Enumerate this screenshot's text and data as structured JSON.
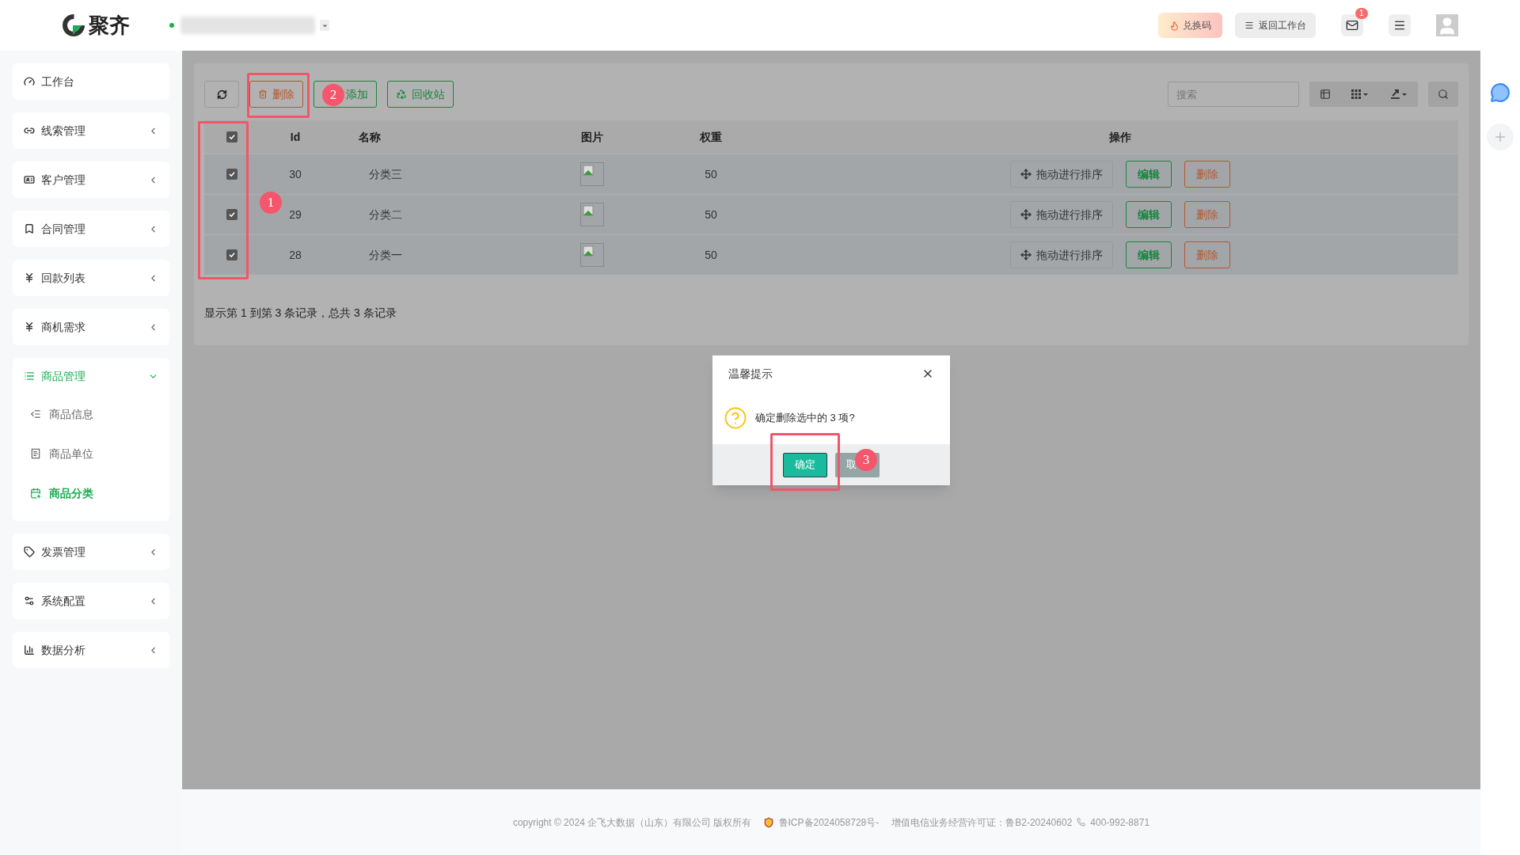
{
  "header": {
    "logo_text": "聚齐",
    "status_online": true,
    "redeem_button": "兑换码",
    "back_button": "返回工作台",
    "mail_badge": "1"
  },
  "sidebar": {
    "items": [
      {
        "label": "工作台",
        "kind": "link"
      },
      {
        "label": "线索管理",
        "kind": "group",
        "expanded": false
      },
      {
        "label": "客户管理",
        "kind": "group",
        "expanded": false
      },
      {
        "label": "合同管理",
        "kind": "group",
        "expanded": false
      },
      {
        "label": "回款列表",
        "kind": "group",
        "expanded": false
      },
      {
        "label": "商机需求",
        "kind": "group",
        "expanded": false
      },
      {
        "label": "商品管理",
        "kind": "group",
        "expanded": true,
        "children": [
          {
            "label": "商品信息",
            "selected": false
          },
          {
            "label": "商品单位",
            "selected": false
          },
          {
            "label": "商品分类",
            "selected": true
          }
        ]
      },
      {
        "label": "发票管理",
        "kind": "group",
        "expanded": false
      },
      {
        "label": "系统配置",
        "kind": "group",
        "expanded": false
      },
      {
        "label": "数据分析",
        "kind": "group",
        "expanded": false
      }
    ]
  },
  "toolbar": {
    "delete_button": "删除",
    "add_button": "添加",
    "recycle_button": "回收站",
    "search": {
      "placeholder": "搜索"
    }
  },
  "table": {
    "all_checked": true,
    "columns": [
      "Id",
      "名称",
      "图片",
      "权重",
      "操作"
    ],
    "rows": [
      {
        "checked": true,
        "id": "30",
        "name": "分类三",
        "weight": "50",
        "sort_button": "拖动进行排序",
        "edit_button": "编辑",
        "delete_button": "删除"
      },
      {
        "checked": true,
        "id": "29",
        "name": "分类二",
        "weight": "50",
        "sort_button": "拖动进行排序",
        "edit_button": "编辑",
        "delete_button": "删除"
      },
      {
        "checked": true,
        "id": "28",
        "name": "分类一",
        "weight": "50",
        "sort_button": "拖动进行排序",
        "edit_button": "编辑",
        "delete_button": "删除"
      }
    ]
  },
  "pagination_text": "显示第 1 到第 3 条记录，总共 3 条记录",
  "dialog": {
    "title": "温馨提示",
    "message": "确定删除选中的 3 项?",
    "confirm_button": "确定",
    "cancel_button": "取"
  },
  "annotations": [
    "1",
    "2",
    "3"
  ],
  "footer": {
    "copyright": "copyright © 2024 企飞大数据（山东）有限公司 版权所有",
    "icp": "鲁ICP备2024058728号-",
    "license": "增值电信业务经营许可证：鲁B2-20240602",
    "phone": "400-992-8871"
  }
}
